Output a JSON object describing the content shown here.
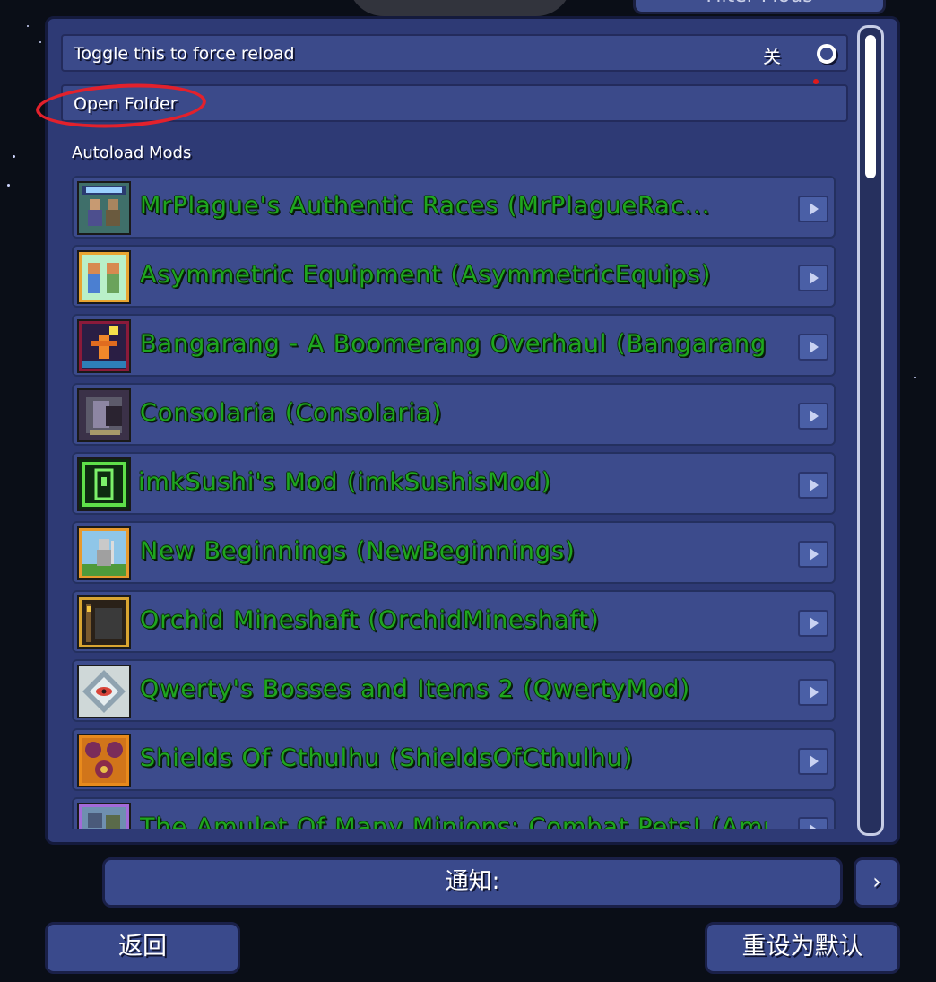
{
  "background_color": "#0a0e17",
  "top_partial_button": "Filter Mods",
  "settings": {
    "reload_label": "Toggle this to force reload",
    "toggle_state_label": "关",
    "open_folder_label": "Open Folder",
    "autoload_label": "Autoload Mods"
  },
  "mods": [
    {
      "name": "MrPlague's Authentic Races (MrPlagueRac...",
      "icon": "races-icon"
    },
    {
      "name": "Asymmetric Equipment (AsymmetricEquips)",
      "icon": "twin-characters-icon"
    },
    {
      "name": "Bangarang - A Boomerang Overhaul (Bangarang)",
      "icon": "boomerang-icon"
    },
    {
      "name": "Consolaria (Consolaria)",
      "icon": "consolaria-icon"
    },
    {
      "name": "imkSushi's Mod (imkSushisMod)",
      "icon": "green-door-icon"
    },
    {
      "name": "New Beginnings (NewBeginnings)",
      "icon": "knight-icon"
    },
    {
      "name": "Orchid Mineshaft (OrchidMineshaft)",
      "icon": "mineshaft-icon"
    },
    {
      "name": "Qwerty's Bosses and Items 2 (QwertyMod)",
      "icon": "eye-emblem-icon"
    },
    {
      "name": "Shields Of Cthulhu (ShieldsOfCthulhu)",
      "icon": "shields-icon"
    },
    {
      "name": "The Amulet Of Many Minions: Combat Pets! (AmuletOf...",
      "icon": "minions-icon"
    }
  ],
  "notification": "通知:",
  "next_label": "›",
  "back_label": "返回",
  "reset_label": "重设为默认",
  "colors": {
    "panel": "#2e3a75",
    "mod_name_green": "#1fa61f",
    "annotation_red": "#e3212c"
  }
}
